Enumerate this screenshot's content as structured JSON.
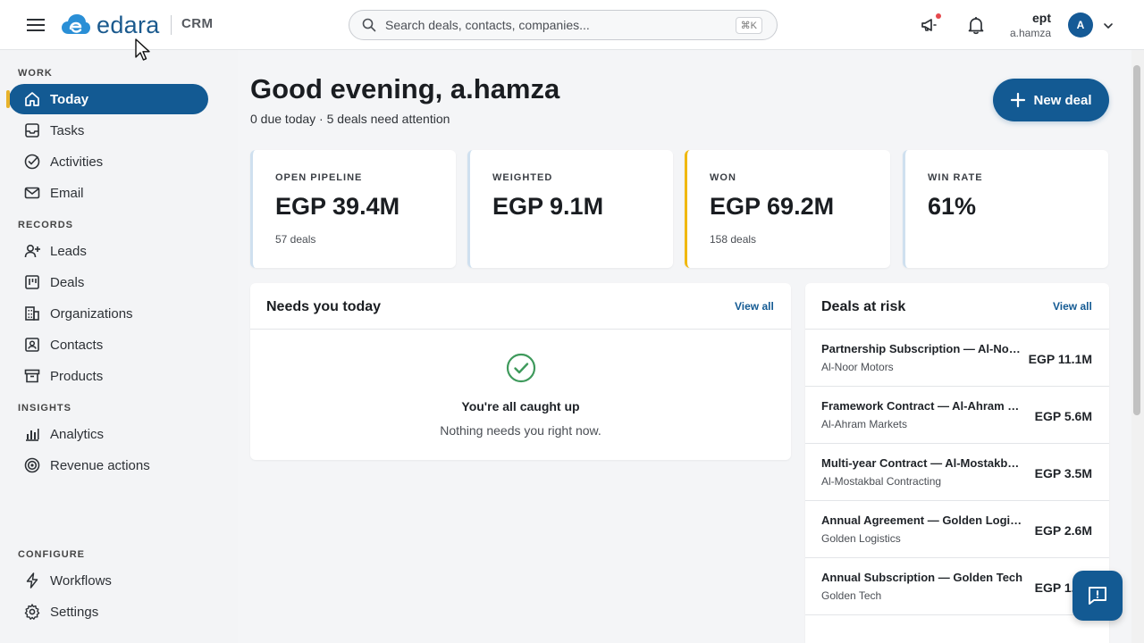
{
  "header": {
    "logo_text": "edara",
    "product": "CRM",
    "search": {
      "placeholder": "Search deals, contacts, companies...",
      "shortcut": "⌘K"
    },
    "user": {
      "org": "ept",
      "username": "a.hamza",
      "avatar_initial": "A"
    }
  },
  "sidebar": {
    "sections": [
      "WORK",
      "RECORDS",
      "INSIGHTS",
      "CONFIGURE"
    ],
    "work": [
      {
        "label": "Today",
        "icon": "home-icon",
        "active": true
      },
      {
        "label": "Tasks",
        "icon": "inbox-icon"
      },
      {
        "label": "Activities",
        "icon": "check-circle-icon"
      },
      {
        "label": "Email",
        "icon": "mail-icon"
      }
    ],
    "records": [
      {
        "label": "Leads",
        "icon": "user-plus-icon"
      },
      {
        "label": "Deals",
        "icon": "kanban-icon"
      },
      {
        "label": "Organizations",
        "icon": "building-icon"
      },
      {
        "label": "Contacts",
        "icon": "contact-card-icon"
      },
      {
        "label": "Products",
        "icon": "archive-box-icon"
      }
    ],
    "insights": [
      {
        "label": "Analytics",
        "icon": "bar-chart-icon"
      },
      {
        "label": "Revenue actions",
        "icon": "target-icon"
      }
    ],
    "configure": [
      {
        "label": "Workflows",
        "icon": "lightning-icon"
      },
      {
        "label": "Settings",
        "icon": "gear-icon"
      }
    ]
  },
  "main": {
    "greeting": "Good evening, a.hamza",
    "subtitle": "0 due today · 5 deals need attention",
    "new_deal_label": "New deal",
    "stats": [
      {
        "label": "OPEN PIPELINE",
        "value": "EGP 39.4M",
        "sub": "57 deals"
      },
      {
        "label": "WEIGHTED",
        "value": "EGP 9.1M",
        "sub": ""
      },
      {
        "label": "WON",
        "value": "EGP 69.2M",
        "sub": "158 deals"
      },
      {
        "label": "WIN RATE",
        "value": "61%",
        "sub": ""
      }
    ],
    "needs_today": {
      "title": "Needs you today",
      "view_all": "View all",
      "empty_title": "You're all caught up",
      "empty_sub": "Nothing needs you right now."
    },
    "deals_at_risk": {
      "title": "Deals at risk",
      "view_all": "View all",
      "items": [
        {
          "name": "Partnership Subscription — Al-Noor Motors",
          "company": "Al-Noor Motors",
          "amount": "EGP 11.1M"
        },
        {
          "name": "Framework Contract — Al-Ahram Markets",
          "company": "Al-Ahram Markets",
          "amount": "EGP 5.6M"
        },
        {
          "name": "Multi-year Contract — Al-Mostakbal Contracting",
          "company": "Al-Mostakbal Contracting",
          "amount": "EGP 3.5M"
        },
        {
          "name": "Annual Agreement — Golden Logistics",
          "company": "Golden Logistics",
          "amount": "EGP 2.6M"
        },
        {
          "name": "Annual Subscription — Golden Tech",
          "company": "Golden Tech",
          "amount": "EGP 1.7M"
        }
      ]
    }
  },
  "colors": {
    "brand": "#135a93",
    "accent_gold": "#f0b80f",
    "success": "#3f9a5c"
  }
}
